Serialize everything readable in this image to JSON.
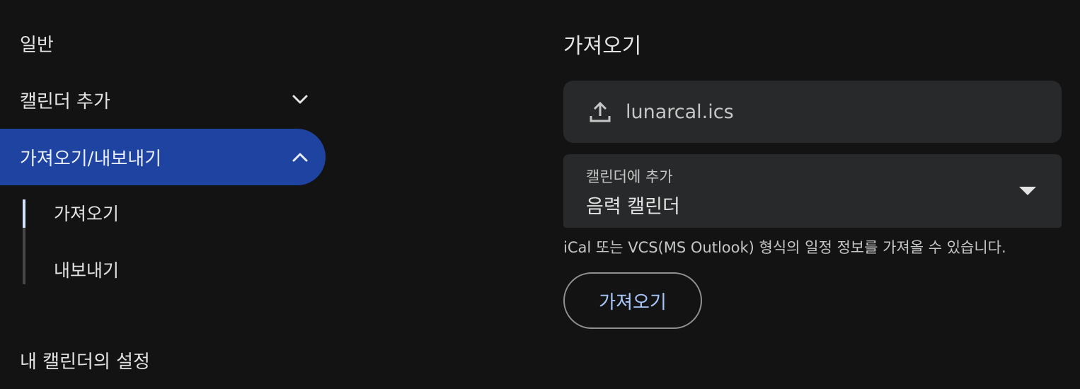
{
  "sidebar": {
    "general": "일반",
    "add_calendar": "캘린더 추가",
    "import_export": "가져오기/내보내기",
    "sub_items": [
      "가져오기",
      "내보내기"
    ],
    "my_calendar_settings": "내 캘린더의 설정"
  },
  "main": {
    "title": "가져오기",
    "file": {
      "icon": "upload-icon",
      "name": "lunarcal.ics"
    },
    "calendar_select": {
      "label": "캘린더에 추가",
      "value": "음력 캘린더",
      "icon": "dropdown-caret-icon"
    },
    "help_text": "iCal 또는 VCS(MS Outlook) 형식의 일정 정보를 가져올 수 있습니다.",
    "import_button": "가져오기"
  },
  "colors": {
    "background": "#131314",
    "active_nav": "#1f43a0",
    "field_bg": "#28292a",
    "button_text": "#a8c7fa"
  }
}
